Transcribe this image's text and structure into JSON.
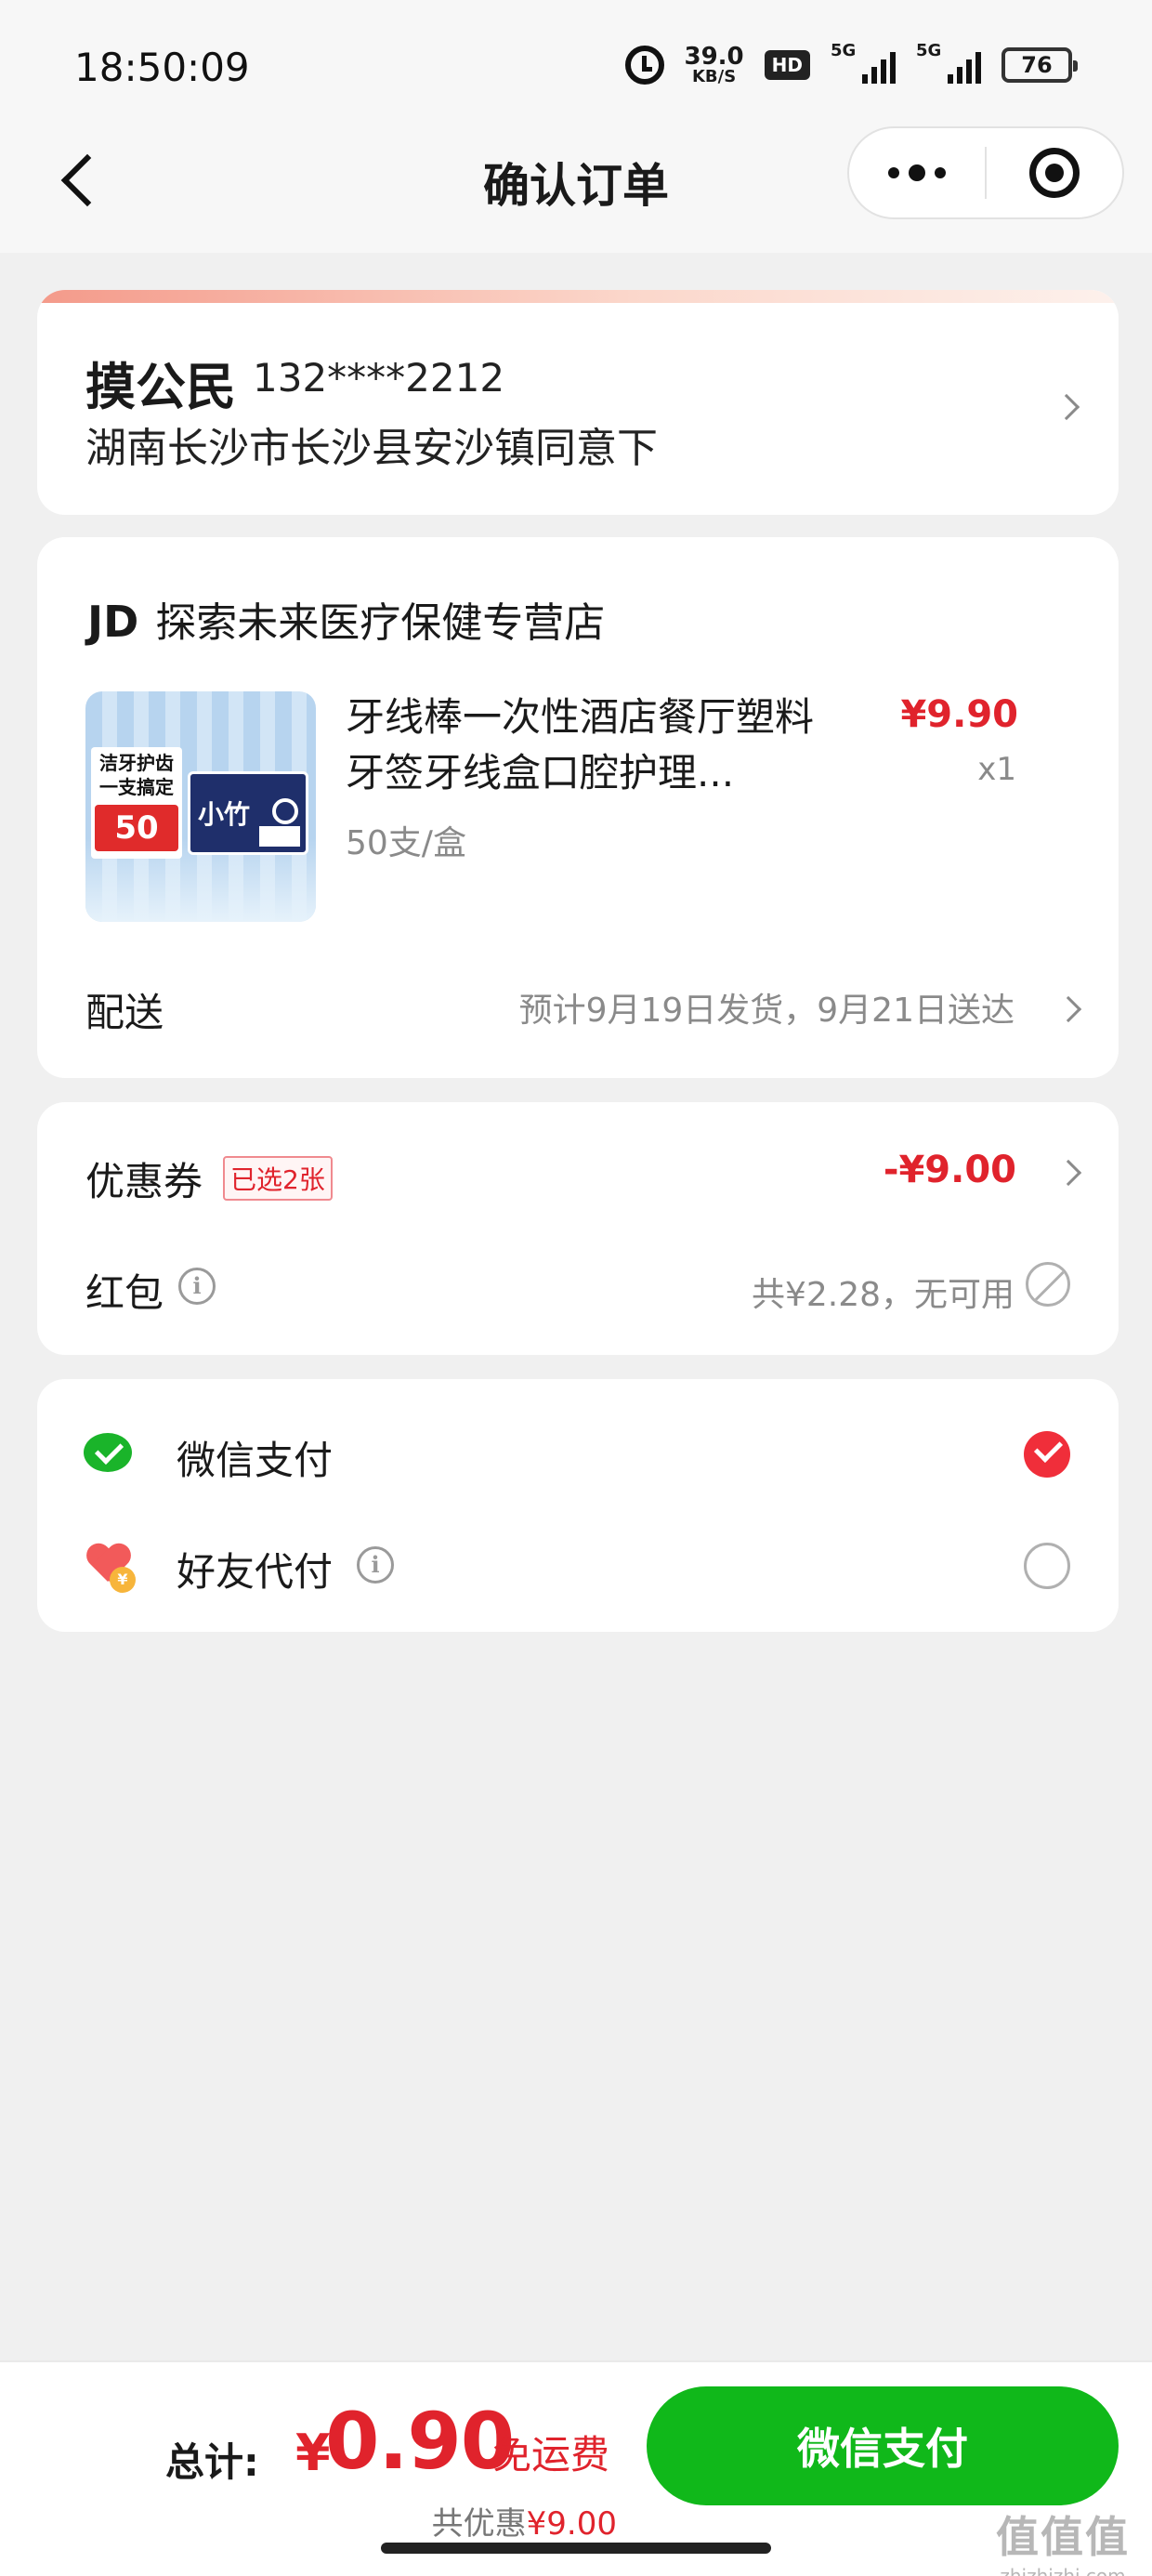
{
  "status_bar": {
    "time": "18:50:09",
    "net_speed": "39.0",
    "net_unit": "KB/S",
    "hd": "HD",
    "signal1": "5G",
    "signal2": "5G",
    "battery": "76"
  },
  "nav": {
    "title": "确认订单",
    "back_icon": "back-arrow-icon",
    "more_icon": "more-dots-icon",
    "close_icon": "target-close-icon"
  },
  "address": {
    "name": "摸公民",
    "phone": "132****2212",
    "detail": "湖南长沙市长沙县安沙镇同意下"
  },
  "shop": {
    "prefix": "JD",
    "name": "探索未来医疗保健专营店"
  },
  "product": {
    "title": "牙线棒一次性酒店餐厅塑料牙签牙线盒口腔护理...",
    "spec": "50支/盒",
    "price": "¥9.90",
    "quantity": "x1",
    "image_text_1": "洁牙护齿一支搞定",
    "image_text_2": "50",
    "image_text_3": "小竹"
  },
  "delivery": {
    "label": "配送",
    "info": "预计9月19日发货，9月21日送达"
  },
  "coupon": {
    "label": "优惠券",
    "badge": "已选2张",
    "amount": "-¥9.00"
  },
  "redpack": {
    "label": "红包",
    "info": "共¥2.28，无可用"
  },
  "payment": {
    "options": [
      {
        "label": "微信支付",
        "icon": "wechat-pay-icon",
        "selected": true
      },
      {
        "label": "好友代付",
        "icon": "friend-pay-heart-icon",
        "selected": false
      }
    ],
    "coin_glyph": "¥"
  },
  "bottom": {
    "total_label": "总计:",
    "currency": "¥",
    "total": "0.90",
    "free_shipping": "免运费",
    "saving_prefix": "共优惠",
    "saving_amount": "¥9.00",
    "pay_button": "微信支付"
  },
  "watermark": {
    "logo": "值值值",
    "url": "zhizhizhi.com"
  },
  "colors": {
    "accent_red": "#e0232c",
    "pay_green": "#10b81a",
    "wechat_green": "#1ab42a"
  }
}
